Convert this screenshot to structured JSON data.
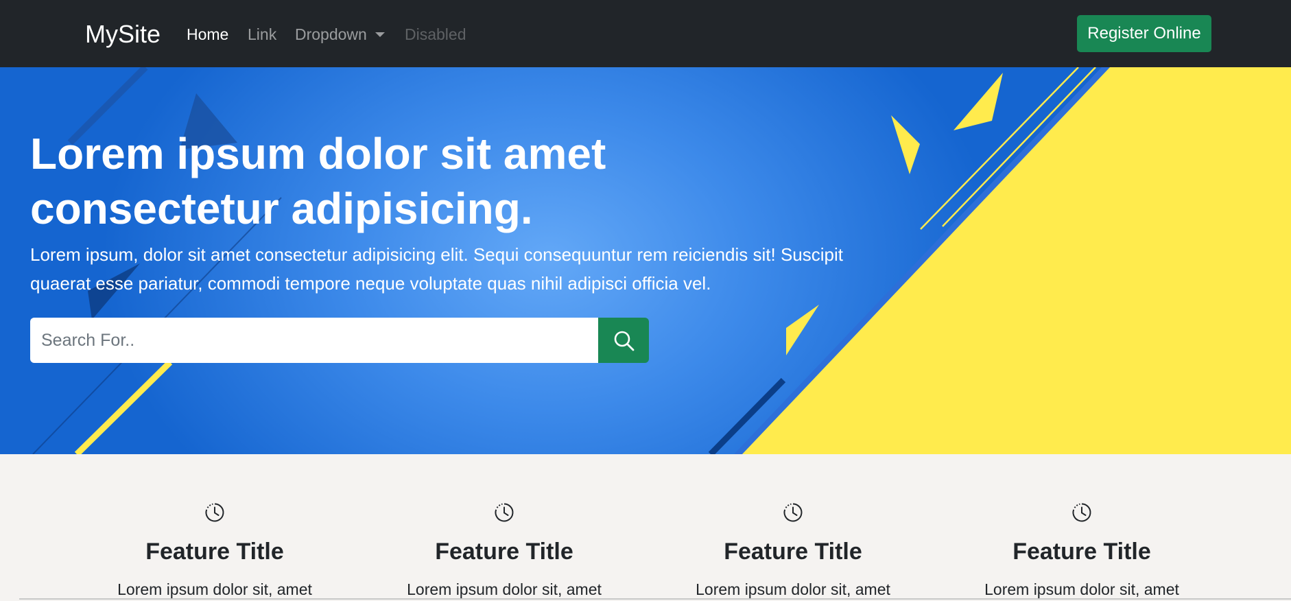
{
  "navbar": {
    "brand": "MySite",
    "links": [
      {
        "label": "Home",
        "state": "active"
      },
      {
        "label": "Link",
        "state": "normal"
      },
      {
        "label": "Dropdown",
        "state": "dropdown"
      },
      {
        "label": "Disabled",
        "state": "disabled"
      }
    ],
    "cta_label": "Register Online"
  },
  "hero": {
    "title": "Lorem ipsum dolor sit amet consectetur adipisicing.",
    "lead": "Lorem ipsum, dolor sit amet consectetur adipisicing elit. Sequi consequuntur rem reiciendis sit! Suscipit quaerat esse pariatur, commodi tempore neque voluptate quas nihil adipisci officia vel.",
    "search": {
      "placeholder": "Search For..",
      "button_icon": "search-icon"
    }
  },
  "features": [
    {
      "icon": "clock-icon",
      "title": "Feature Title",
      "text": "Lorem ipsum dolor sit, amet"
    },
    {
      "icon": "clock-icon",
      "title": "Feature Title",
      "text": "Lorem ipsum dolor sit, amet"
    },
    {
      "icon": "clock-icon",
      "title": "Feature Title",
      "text": "Lorem ipsum dolor sit, amet"
    },
    {
      "icon": "clock-icon",
      "title": "Feature Title",
      "text": "Lorem ipsum dolor sit, amet"
    }
  ],
  "colors": {
    "navbar_bg": "#212529",
    "accent_green": "#198754",
    "hero_blue": "#1565d0",
    "hero_yellow": "#ffeb4d",
    "page_bg": "#f5f3f1"
  }
}
